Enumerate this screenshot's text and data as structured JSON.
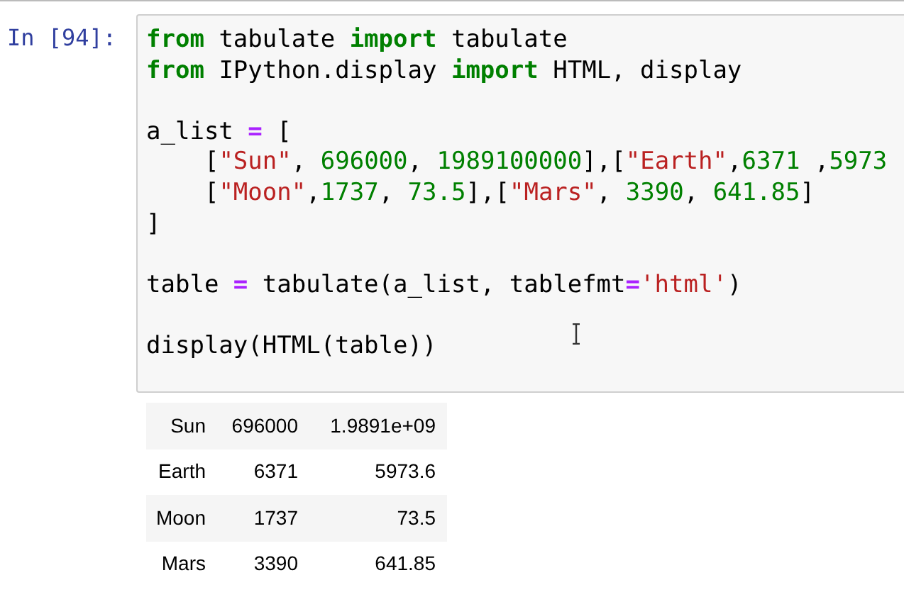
{
  "cell": {
    "prompt": "In [94]:",
    "code_lines": [
      {
        "tokens": [
          {
            "kind": "keyword",
            "text": "from"
          },
          {
            "kind": "name",
            "text": " tabulate "
          },
          {
            "kind": "keyword",
            "text": "import"
          },
          {
            "kind": "name",
            "text": " tabulate"
          }
        ]
      },
      {
        "tokens": [
          {
            "kind": "keyword",
            "text": "from"
          },
          {
            "kind": "name",
            "text": " IPython.display "
          },
          {
            "kind": "keyword",
            "text": "import"
          },
          {
            "kind": "name",
            "text": " HTML, display"
          }
        ],
        "blank_after": true
      },
      {
        "tokens": [
          {
            "kind": "name",
            "text": "a_list "
          },
          {
            "kind": "operator",
            "text": "="
          },
          {
            "kind": "name",
            "text": " ["
          }
        ]
      },
      {
        "tokens": [
          {
            "kind": "name",
            "text": "    ["
          },
          {
            "kind": "string",
            "text": "\"Sun\""
          },
          {
            "kind": "name",
            "text": ", "
          },
          {
            "kind": "number",
            "text": "696000"
          },
          {
            "kind": "name",
            "text": ", "
          },
          {
            "kind": "number",
            "text": "1989100000"
          },
          {
            "kind": "name",
            "text": "],["
          },
          {
            "kind": "string",
            "text": "\"Earth\""
          },
          {
            "kind": "name",
            "text": ","
          },
          {
            "kind": "number",
            "text": "6371"
          },
          {
            "kind": "name",
            "text": " ,"
          },
          {
            "kind": "number",
            "text": "5973"
          }
        ]
      },
      {
        "tokens": [
          {
            "kind": "name",
            "text": "    ["
          },
          {
            "kind": "string",
            "text": "\"Moon\""
          },
          {
            "kind": "name",
            "text": ","
          },
          {
            "kind": "number",
            "text": "1737"
          },
          {
            "kind": "name",
            "text": ", "
          },
          {
            "kind": "number",
            "text": "73.5"
          },
          {
            "kind": "name",
            "text": "],["
          },
          {
            "kind": "string",
            "text": "\"Mars\""
          },
          {
            "kind": "name",
            "text": ", "
          },
          {
            "kind": "number",
            "text": "3390"
          },
          {
            "kind": "name",
            "text": ", "
          },
          {
            "kind": "number",
            "text": "641.85"
          },
          {
            "kind": "name",
            "text": "]"
          }
        ]
      },
      {
        "tokens": [
          {
            "kind": "name",
            "text": "]"
          }
        ],
        "blank_after": true
      },
      {
        "tokens": [
          {
            "kind": "name",
            "text": "table "
          },
          {
            "kind": "operator",
            "text": "="
          },
          {
            "kind": "name",
            "text": " tabulate(a_list, tablefmt"
          },
          {
            "kind": "operator",
            "text": "="
          },
          {
            "kind": "string",
            "text": "'html'"
          },
          {
            "kind": "name",
            "text": ")"
          }
        ],
        "blank_after": true
      },
      {
        "tokens": [
          {
            "kind": "name",
            "text": "display(HTML(table))"
          }
        ]
      }
    ]
  },
  "output_table": {
    "rows": [
      [
        "Sun",
        "696000",
        "1.9891e+09"
      ],
      [
        "Earth",
        "6371",
        "5973.6"
      ],
      [
        "Moon",
        "1737",
        "73.5"
      ],
      [
        "Mars",
        "3390",
        "641.85"
      ]
    ]
  }
}
